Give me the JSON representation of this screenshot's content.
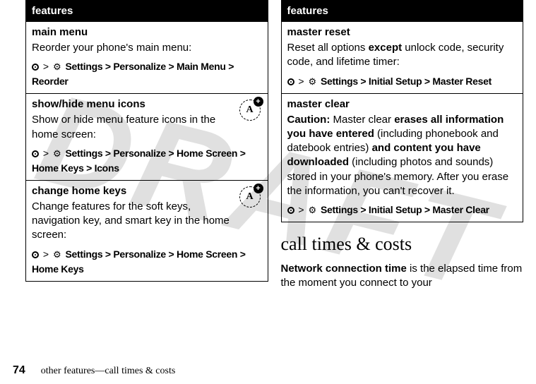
{
  "watermark": "DRAFT",
  "left": {
    "header": "features",
    "rows": [
      {
        "title": "main menu",
        "body": "Reorder your phone's main menu:",
        "path_prefix": "> ",
        "path": "Settings > Personalize > Main Menu > Reorder",
        "badge": false
      },
      {
        "title": "show/hide menu icons",
        "body": "Show or hide menu feature icons in the home screen:",
        "path_prefix": "> ",
        "path": "Settings > Personalize > Home Screen > Home Keys > Icons",
        "badge": true
      },
      {
        "title": "change home keys",
        "body": "Change features for the soft keys, navigation key, and smart key in the home screen:",
        "path_prefix": "> ",
        "path": "Settings > Personalize > Home Screen > Home Keys",
        "badge": true
      }
    ]
  },
  "right": {
    "header": "features",
    "rows": [
      {
        "title": "master reset",
        "body_pre": "Reset all options ",
        "body_bold": "except",
        "body_post": " unlock code, security code, and lifetime timer:",
        "path": "Settings > Initial Setup > Master Reset"
      },
      {
        "title": "master clear",
        "caution_label": "Caution:",
        "caution_a": " Master clear ",
        "caution_b1": "erases all information you have entered",
        "caution_c": " (including phonebook and datebook entries) ",
        "caution_b2": "and content you have downloaded",
        "caution_d": " (including photos and sounds) stored in your phone's memory. After you erase the information, you can't recover it.",
        "path": "Settings > Initial Setup > Master Clear"
      }
    ],
    "section_title": "call times & costs",
    "section_body_b": "Network connection time",
    "section_body_rest": " is the elapsed time from the moment you connect to your"
  },
  "footer": {
    "page": "74",
    "text": "other features—call times & costs"
  },
  "gear_glyph": "⚙"
}
